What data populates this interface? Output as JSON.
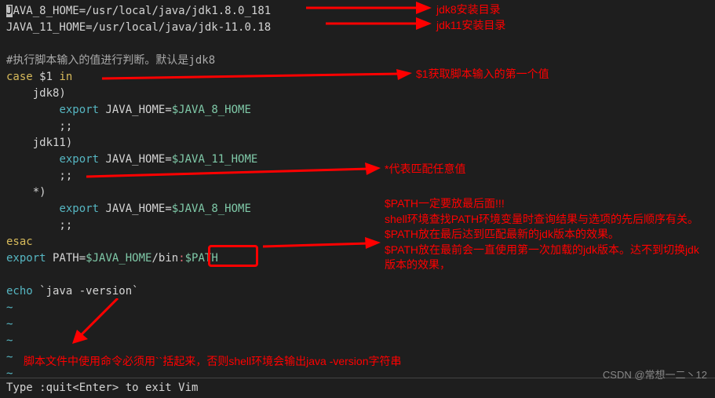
{
  "code": {
    "l1a": "J",
    "l1b": "AVA_8_HOME",
    "l1c": "=",
    "l1d": "/usr/local/java/jdk1.8.0_181",
    "l2a": "JAVA_11_HOME",
    "l2b": "=",
    "l2c": "/usr/local/java/jdk-11.0.18",
    "l3": "",
    "l4": "#执行脚本输入的值进行判断。默认是jdk8",
    "l5a": "case",
    "l5b": " $1 ",
    "l5c": "in",
    "l6": "    jdk8)",
    "l7a": "        ",
    "l7b": "export",
    "l7c": " JAVA_HOME",
    "l7d": "=",
    "l7e": "$JAVA_8_HOME",
    "l8": "        ;;",
    "l9": "    jdk11)",
    "l10a": "        ",
    "l10b": "export",
    "l10c": " JAVA_HOME",
    "l10d": "=",
    "l10e": "$JAVA_11_HOME",
    "l11": "        ;;",
    "l12": "    *)",
    "l13a": "        ",
    "l13b": "export",
    "l13c": " JAVA_HOME",
    "l13d": "=",
    "l13e": "$JAVA_8_HOME",
    "l14": "        ;;",
    "l15": "esac",
    "l16a": "export",
    "l16b": " PATH",
    "l16c": "=",
    "l16d": "$JAVA_HOME",
    "l16e": "/bin",
    "l16f": ":",
    "l16g": "$PATH",
    "l17": "",
    "l18a": "echo",
    "l18b": " `java -version`",
    "tilde": "~",
    "statusbar": "Type  :quit<Enter>  to exit Vim"
  },
  "annot": {
    "a1": "jdk8安装目录",
    "a2": "jdk11安装目录",
    "a3": "$1获取脚本输入的第一个值",
    "a4": "*代表匹配任意值",
    "a5a": "$PATH一定要放最后面!!!",
    "a5b": "shell环境查找PATH环境变量时查询结果与选项的先后顺序有关。",
    "a5c": "$PATH放在最后达到匹配最新的jdk版本的效果。",
    "a5d": "$PATH放在最前会一直使用第一次加载的jdk版本。达不到切换jdk版本的效果，",
    "a6": "脚本文件中使用命令必须用``括起来，否则shell环境会输出java -version字符串",
    "watermark": "CSDN @常想一二丶12"
  }
}
